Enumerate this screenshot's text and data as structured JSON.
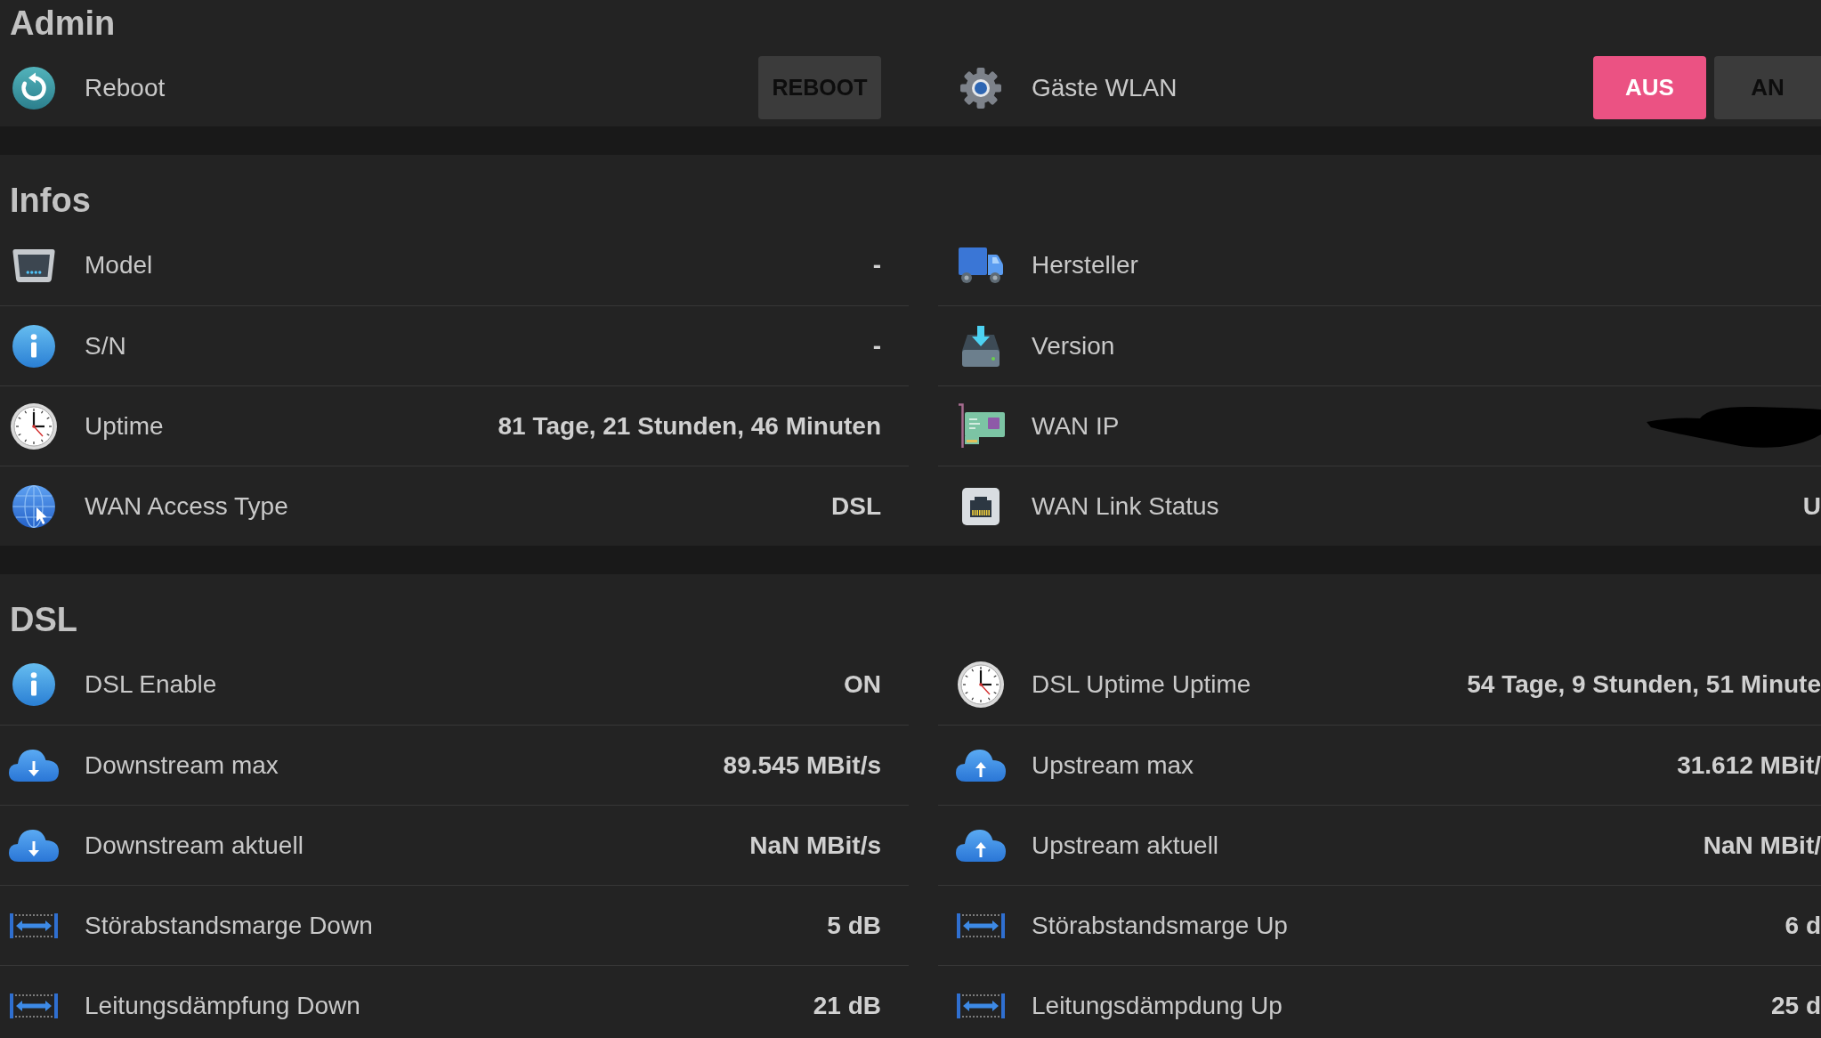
{
  "sections": [
    {
      "title": "Admin",
      "columns": [
        {
          "items": [
            {
              "kind": "button",
              "label": "Reboot",
              "button": "REBOOT"
            }
          ]
        },
        {
          "items": [
            {
              "kind": "toggle",
              "label": "Gäste WLAN",
              "options": [
                {
                  "label": "AUS",
                  "selected": true
                },
                {
                  "label": "AN",
                  "selected": false
                }
              ]
            }
          ]
        }
      ]
    },
    {
      "title": "Infos",
      "columns": [
        {
          "items": [
            {
              "kind": "info",
              "label": "Model",
              "value": "-"
            },
            {
              "kind": "info",
              "label": "S/N",
              "value": "-"
            },
            {
              "kind": "info",
              "label": "Uptime",
              "value": "81 Tage, 21 Stunden, 46 Minuten"
            },
            {
              "kind": "info",
              "label": "WAN Access Type",
              "value": "DSL"
            }
          ]
        },
        {
          "items": [
            {
              "kind": "info",
              "label": "Hersteller"
            },
            {
              "kind": "info",
              "label": "Version"
            },
            {
              "kind": "info",
              "label": "WAN IP",
              "redacted": true
            },
            {
              "kind": "info",
              "label": "WAN Link Status",
              "value": "U"
            }
          ]
        }
      ]
    },
    {
      "title": "DSL",
      "columns": [
        {
          "items": [
            {
              "kind": "info",
              "label": "DSL Enable",
              "value": "ON"
            },
            {
              "kind": "info",
              "label": "Downstream max",
              "value": "89.545 MBit/s"
            },
            {
              "kind": "info",
              "label": "Downstream aktuell",
              "value": "NaN MBit/s"
            },
            {
              "kind": "info",
              "label": "Störabstandsmarge Down",
              "value": "5 dB"
            },
            {
              "kind": "info",
              "label": "Leitungsdämpfung Down",
              "value": "21 dB"
            }
          ]
        },
        {
          "items": [
            {
              "kind": "info",
              "label": "DSL Uptime Uptime",
              "value": "54 Tage, 9 Stunden, 51 Minute"
            },
            {
              "kind": "info",
              "label": "Upstream max",
              "value": "31.612 MBit/"
            },
            {
              "kind": "info",
              "label": "Upstream aktuell",
              "value": "NaN MBit/"
            },
            {
              "kind": "info",
              "label": "Störabstandsmarge Up",
              "value": "6 d"
            },
            {
              "kind": "info",
              "label": "Leitungsdämpdung Up",
              "value": "25 d"
            }
          ]
        }
      ]
    }
  ]
}
